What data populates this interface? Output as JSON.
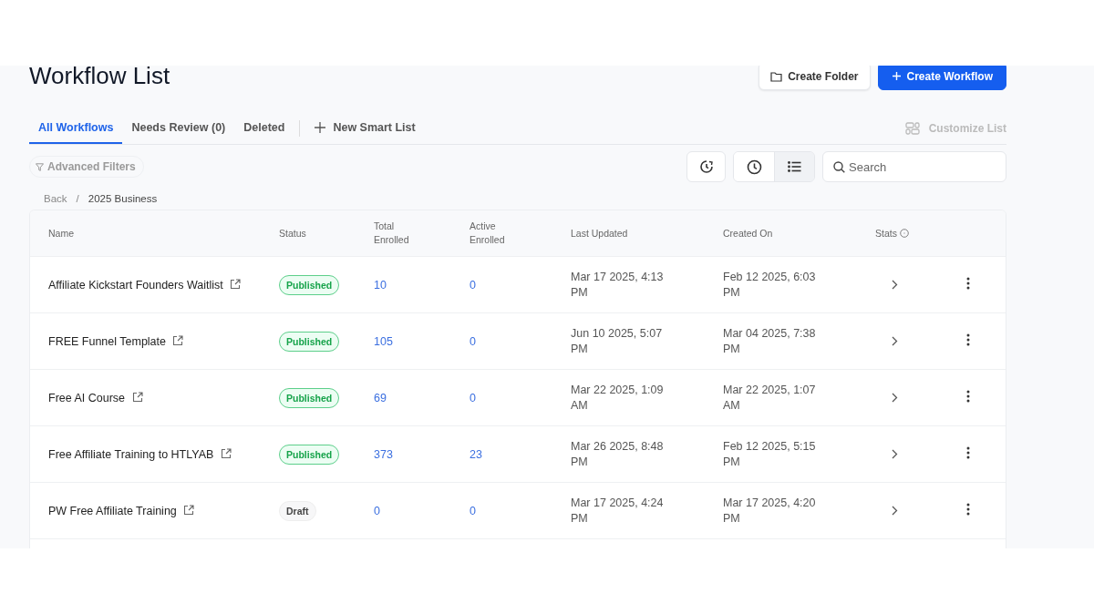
{
  "page": {
    "title": "Workflow List"
  },
  "header_buttons": [
    {
      "label": "Create Folder",
      "kind": "secondary"
    },
    {
      "label": "Create Workflow",
      "kind": "primary"
    }
  ],
  "tabs": [
    {
      "label": "All Workflows",
      "selected": true
    },
    {
      "label": "Needs Review (0)",
      "selected": false
    },
    {
      "label": "Deleted",
      "selected": false
    }
  ],
  "new_smart_list": "New Smart List",
  "customize_list": "Customize List",
  "advanced_filters": "Advanced Filters",
  "view_toggle": [
    {
      "kind": "clock",
      "selected": false
    },
    {
      "kind": "list",
      "selected": true
    }
  ],
  "search": {
    "placeholder": "Search"
  },
  "breadcrumb": {
    "separator": "/",
    "items": [
      "Back",
      "2025 Business"
    ]
  },
  "table": {
    "columns": [
      "Name",
      "Status",
      "Total Enrolled",
      "Active Enrolled",
      "Last Updated",
      "Created On",
      "Stats"
    ],
    "rows": [
      {
        "name": "Affiliate Kickstart Founders Waitlist",
        "status": "Published",
        "kind": "published",
        "total_enrolled": "10",
        "active_enrolled": "0",
        "last_updated": "Mar 17 2025, 4:13 PM",
        "created_on": "Feb 12 2025, 6:03 PM"
      },
      {
        "name": "FREE Funnel Template",
        "status": "Published",
        "kind": "published",
        "total_enrolled": "105",
        "active_enrolled": "0",
        "last_updated": "Jun 10 2025, 5:07 PM",
        "created_on": "Mar 04 2025, 7:38 PM"
      },
      {
        "name": "Free AI Course",
        "status": "Published",
        "kind": "published",
        "total_enrolled": "69",
        "active_enrolled": "0",
        "last_updated": "Mar 22 2025, 1:09 AM",
        "created_on": "Mar 22 2025, 1:07 AM"
      },
      {
        "name": "Free Affiliate Training to HTLYAB",
        "status": "Published",
        "kind": "published",
        "total_enrolled": "373",
        "active_enrolled": "23",
        "last_updated": "Mar 26 2025, 8:48 PM",
        "created_on": "Feb 12 2025, 5:15 PM"
      },
      {
        "name": "PW Free Affiliate Training",
        "status": "Draft",
        "kind": "draft",
        "total_enrolled": "0",
        "active_enrolled": "0",
        "last_updated": "Mar 17 2025, 4:24 PM",
        "created_on": "Mar 17 2025, 4:20 PM"
      }
    ]
  }
}
